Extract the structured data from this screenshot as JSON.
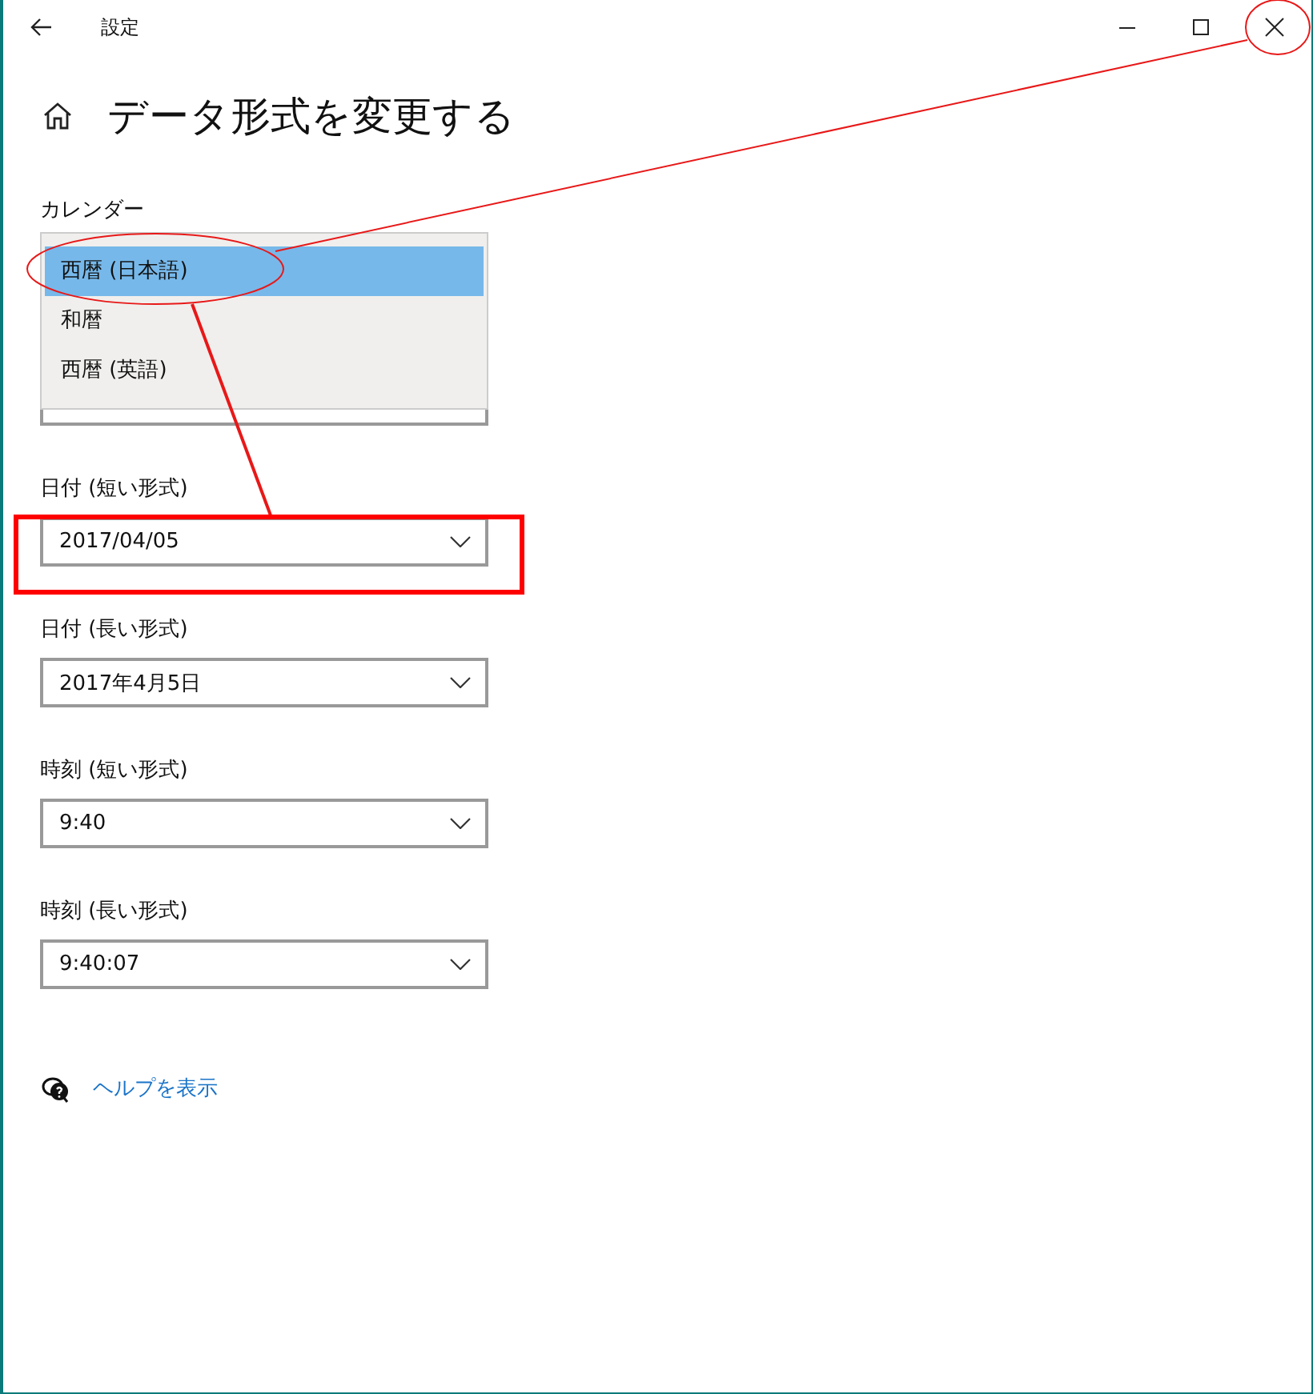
{
  "window": {
    "title": "設定"
  },
  "page_title": "データ形式を変更する",
  "calendar": {
    "label": "カレンダー",
    "options": [
      {
        "label": "西暦 (日本語)",
        "selected": true
      },
      {
        "label": "和暦",
        "selected": false
      },
      {
        "label": "西暦 (英語)",
        "selected": false
      }
    ]
  },
  "fields": [
    {
      "label": "日付 (短い形式)",
      "value": "2017/04/05"
    },
    {
      "label": "日付 (長い形式)",
      "value": "2017年4月5日"
    },
    {
      "label": "時刻 (短い形式)",
      "value": "9:40"
    },
    {
      "label": "時刻 (長い形式)",
      "value": "9:40:07"
    }
  ],
  "help_link": "ヘルプを表示"
}
